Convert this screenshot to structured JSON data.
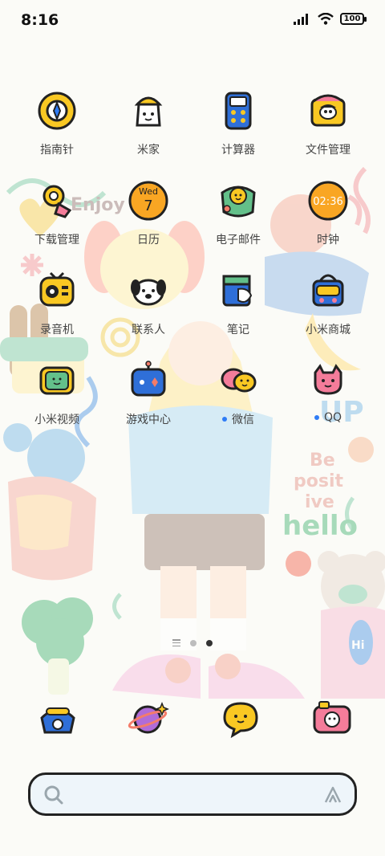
{
  "status_bar": {
    "time": "8:16",
    "battery": "100"
  },
  "apps": [
    {
      "label": "指南针",
      "icon": "compass-icon"
    },
    {
      "label": "米家",
      "icon": "mijia-icon"
    },
    {
      "label": "计算器",
      "icon": "calculator-icon"
    },
    {
      "label": "文件管理",
      "icon": "file-manager-icon"
    },
    {
      "label": "下载管理",
      "icon": "downloads-icon"
    },
    {
      "label": "日历",
      "icon": "calendar-icon",
      "day_name": "Wed",
      "day_number": "7"
    },
    {
      "label": "电子邮件",
      "icon": "email-icon"
    },
    {
      "label": "时钟",
      "icon": "clock-icon",
      "time": "02:36"
    },
    {
      "label": "录音机",
      "icon": "recorder-icon"
    },
    {
      "label": "联系人",
      "icon": "contacts-icon"
    },
    {
      "label": "笔记",
      "icon": "notes-icon"
    },
    {
      "label": "小米商城",
      "icon": "mi-store-icon"
    },
    {
      "label": "小米视频",
      "icon": "mi-video-icon"
    },
    {
      "label": "游戏中心",
      "icon": "game-center-icon"
    },
    {
      "label": "微信",
      "icon": "wechat-icon",
      "new_dot": true
    },
    {
      "label": "QQ",
      "icon": "qq-icon",
      "new_dot": true
    }
  ],
  "dock": [
    {
      "icon": "phone-icon"
    },
    {
      "icon": "browser-icon"
    },
    {
      "icon": "messages-icon"
    },
    {
      "icon": "camera-icon"
    }
  ],
  "wallpaper_text": [
    "Enjoy",
    "UP",
    "Be",
    "posit",
    "ive",
    "hello",
    "Hi"
  ],
  "page_indicator": {
    "pages": 2,
    "active": 2
  },
  "colors": {
    "accent_blue": "#2f7cf6",
    "icon_yellow": "#f9c823",
    "outline": "#222222"
  }
}
